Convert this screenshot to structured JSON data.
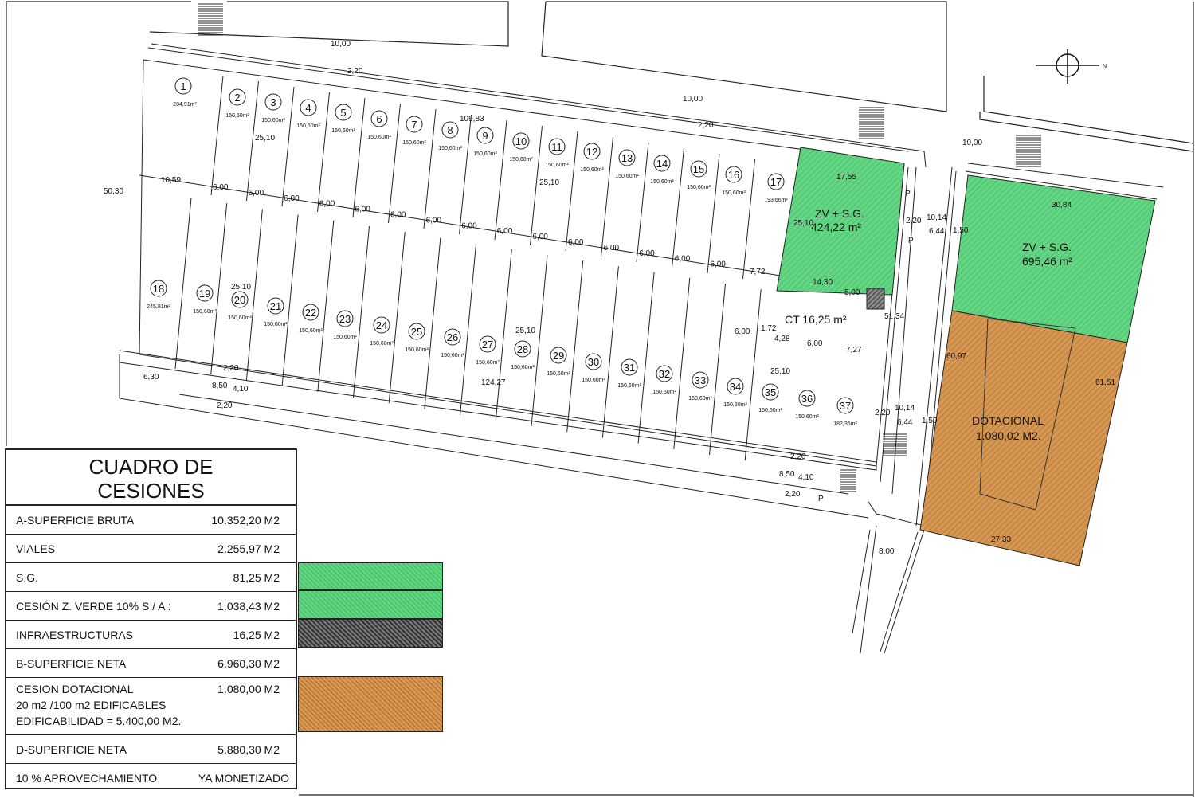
{
  "lots": [
    {
      "n": "1",
      "area": "284,91m²"
    },
    {
      "n": "2",
      "area": "150,60m²"
    },
    {
      "n": "3",
      "area": "150,60m²"
    },
    {
      "n": "4",
      "area": "150,60m²"
    },
    {
      "n": "5",
      "area": "150,60m²"
    },
    {
      "n": "6",
      "area": "150,60m²"
    },
    {
      "n": "7",
      "area": "150,60m²"
    },
    {
      "n": "8",
      "area": "150,60m²"
    },
    {
      "n": "9",
      "area": "150,60m²"
    },
    {
      "n": "10",
      "area": "150,60m²"
    },
    {
      "n": "11",
      "area": "150,60m²"
    },
    {
      "n": "12",
      "area": "150,60m²"
    },
    {
      "n": "13",
      "area": "150,60m²"
    },
    {
      "n": "14",
      "area": "150,60m²"
    },
    {
      "n": "15",
      "area": "150,60m²"
    },
    {
      "n": "16",
      "area": "150,60m²"
    },
    {
      "n": "17",
      "area": "193,66m²"
    },
    {
      "n": "18",
      "area": "245,81m²"
    },
    {
      "n": "19",
      "area": "150,60m²"
    },
    {
      "n": "20",
      "area": "150,60m²"
    },
    {
      "n": "21",
      "area": "150,60m²"
    },
    {
      "n": "22",
      "area": "150,60m²"
    },
    {
      "n": "23",
      "area": "150,60m²"
    },
    {
      "n": "24",
      "area": "150,60m²"
    },
    {
      "n": "25",
      "area": "150,60m²"
    },
    {
      "n": "26",
      "area": "150,60m²"
    },
    {
      "n": "27",
      "area": "150,60m²"
    },
    {
      "n": "28",
      "area": "150,60m²"
    },
    {
      "n": "29",
      "area": "150,60m²"
    },
    {
      "n": "30",
      "area": "150,60m²"
    },
    {
      "n": "31",
      "area": "150,60m²"
    },
    {
      "n": "32",
      "area": "150,60m²"
    },
    {
      "n": "33",
      "area": "150,60m²"
    },
    {
      "n": "34",
      "area": "150,60m²"
    },
    {
      "n": "35",
      "area": "150,60m²"
    },
    {
      "n": "36",
      "area": "150,60m²"
    },
    {
      "n": "37",
      "area": "182,36m²"
    }
  ],
  "zones": {
    "zv1_name": "ZV + S.G.",
    "zv1_area": "424,22 m²",
    "zv2_name": "ZV + S.G.",
    "zv2_area": "695,46 m²",
    "dot_name": "DOTACIONAL",
    "dot_area": "1.080,02 M2.",
    "ct": "CT 16,25 m²"
  },
  "dims": {
    "d10a": "10,00",
    "d220a": "2,20",
    "d10b": "10,00",
    "d220b": "2,20",
    "d10c": "10,00",
    "d10983": "109,83",
    "d2510a": "25,10",
    "d2510b": "25,10",
    "d2510c": "25,10",
    "d2510d": "25,10",
    "d2510e": "25,10",
    "d5030": "50,30",
    "d1059": "10,59",
    "d600": "6,00",
    "d772": "7,72",
    "d1755": "17,55",
    "d1430": "14,30",
    "d500": "5,00",
    "d220c": "2,20",
    "d1014a": "10,14",
    "d644a": "6,44",
    "d150a": "1,50",
    "d3084": "30,84",
    "d5134": "51,34",
    "d6097": "60,97",
    "d6151": "61,51",
    "d172": "1,72",
    "d428": "4,28",
    "d727": "7,27",
    "d12427": "124,27",
    "d630": "6,30",
    "d220d": "2,20",
    "d850a": "8,50",
    "d410a": "4,10",
    "d220e": "2,20",
    "d1014b": "10,14",
    "d644b": "6,44",
    "d150b": "1,50",
    "d220f": "2,20",
    "d850b": "8,50",
    "d410b": "4,10",
    "d220g": "2,20",
    "d2733": "27,33",
    "d800": "8,00",
    "p": "P",
    "north": "N"
  },
  "legend": {
    "title_line1": "CUADRO DE",
    "title_line2": "CESIONES",
    "rows": [
      {
        "k": "A-SUPERFICIE BRUTA",
        "v": "10.352,20 M2"
      },
      {
        "k": "VIALES",
        "v": "2.255,97 M2"
      },
      {
        "k": "S.G.",
        "v": "81,25 M2"
      },
      {
        "k": "CESIÓN Z. VERDE 10% S / A :",
        "v": "1.038,43 M2"
      },
      {
        "k": "INFRAESTRUCTURAS",
        "v": "16,25 M2"
      },
      {
        "k": "B-SUPERFICIE NETA",
        "v": "6.960,30 M2"
      },
      {
        "k1": "CESION DOTACIONAL",
        "k2": "20 m2 /100 m2 EDIFICABLES",
        "k3": "EDIFICABILIDAD = 5.400,00 M2.",
        "v": "1.080,00 M2"
      },
      {
        "k": "D-SUPERFICIE NETA",
        "v": "5.880,30 M2"
      },
      {
        "k": "10 % APROVECHAMIENTO",
        "v": "YA MONETIZADO"
      }
    ]
  },
  "colors": {
    "green": "#5fd67f",
    "dotacional": "#c98a45",
    "infra": "#555555",
    "line": "#222222"
  }
}
